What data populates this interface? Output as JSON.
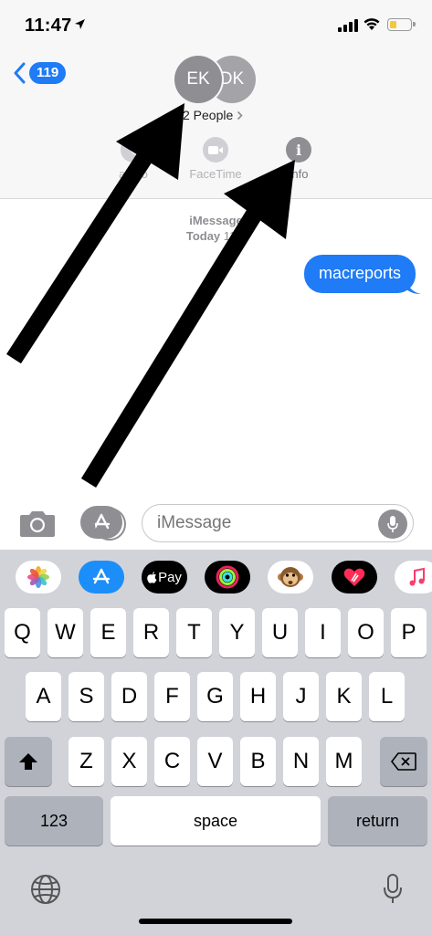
{
  "status_bar": {
    "time": "11:47",
    "location_icon": "location-arrow-icon",
    "battery_color": "#f4c83c",
    "battery_level": 0.35
  },
  "header": {
    "back_count": "119",
    "avatars": [
      "EK",
      "DK"
    ],
    "people_label": "2 People",
    "actions": [
      {
        "label": "audio",
        "icon": "phone-icon"
      },
      {
        "label": "FaceTime",
        "icon": "video-camera-icon"
      },
      {
        "label": "info",
        "icon": "info-icon"
      }
    ]
  },
  "messages": {
    "service": "iMessage",
    "day": "Today",
    "time": "11:4",
    "bubbles": [
      {
        "text": "macreports",
        "sent": true
      }
    ]
  },
  "composer": {
    "placeholder": "iMessage",
    "camera_icon": "camera-icon",
    "apps_icon": "app-store-icon",
    "mic_icon": "microphone-icon"
  },
  "app_strip": {
    "apps": [
      "photos-icon",
      "app-store-icon",
      "apple-pay-icon",
      "activity-icon",
      "animoji-monkey-icon",
      "digital-touch-icon",
      "music-icon"
    ],
    "apple_pay_label": "Pay"
  },
  "keyboard": {
    "row1": [
      "Q",
      "W",
      "E",
      "R",
      "T",
      "Y",
      "U",
      "I",
      "O",
      "P"
    ],
    "row2": [
      "A",
      "S",
      "D",
      "F",
      "G",
      "H",
      "J",
      "K",
      "L"
    ],
    "row3": [
      "Z",
      "X",
      "C",
      "V",
      "B",
      "N",
      "M"
    ],
    "numbers_label": "123",
    "space_label": "space",
    "return_label": "return"
  },
  "colors": {
    "accent_blue": "#1f7bf6",
    "avatar_gray": "#8e8e93",
    "keyboard_bg": "#d1d3d9"
  }
}
